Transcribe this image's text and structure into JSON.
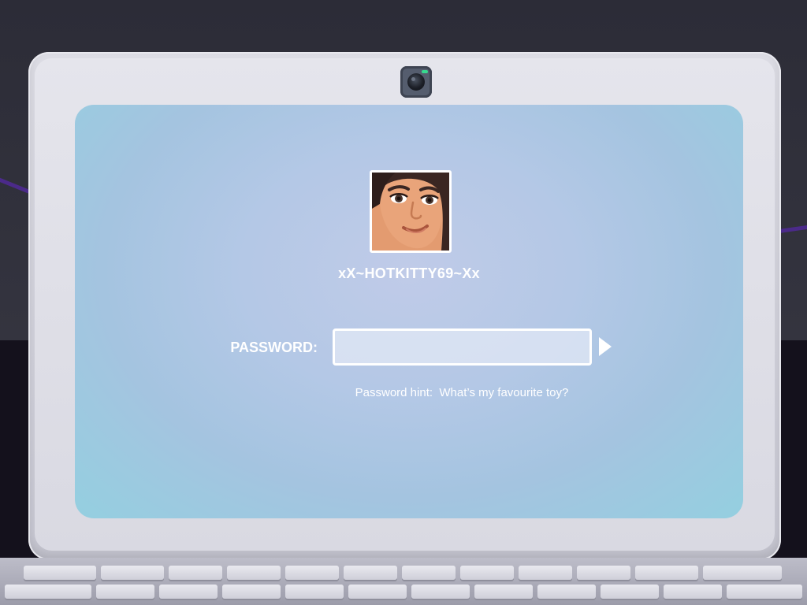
{
  "login": {
    "username": "xX~HOTKITTY69~Xx",
    "password_label": "PASSWORD:",
    "password_value": "",
    "password_placeholder": "",
    "hint_label": "Password hint:",
    "hint_text": "What's my favourite toy?",
    "hint_full": "Password hint:  What’s my favourite toy?"
  },
  "icons": {
    "webcam": "webcam-icon",
    "submit": "play-arrow-icon",
    "avatar": "profile-avatar"
  },
  "colors": {
    "screen_center": "#c0cbe8",
    "screen_edge": "#94cfe0",
    "text": "#ffffff",
    "webcam_led": "#38d98f",
    "cable": "#4b2a8a"
  }
}
